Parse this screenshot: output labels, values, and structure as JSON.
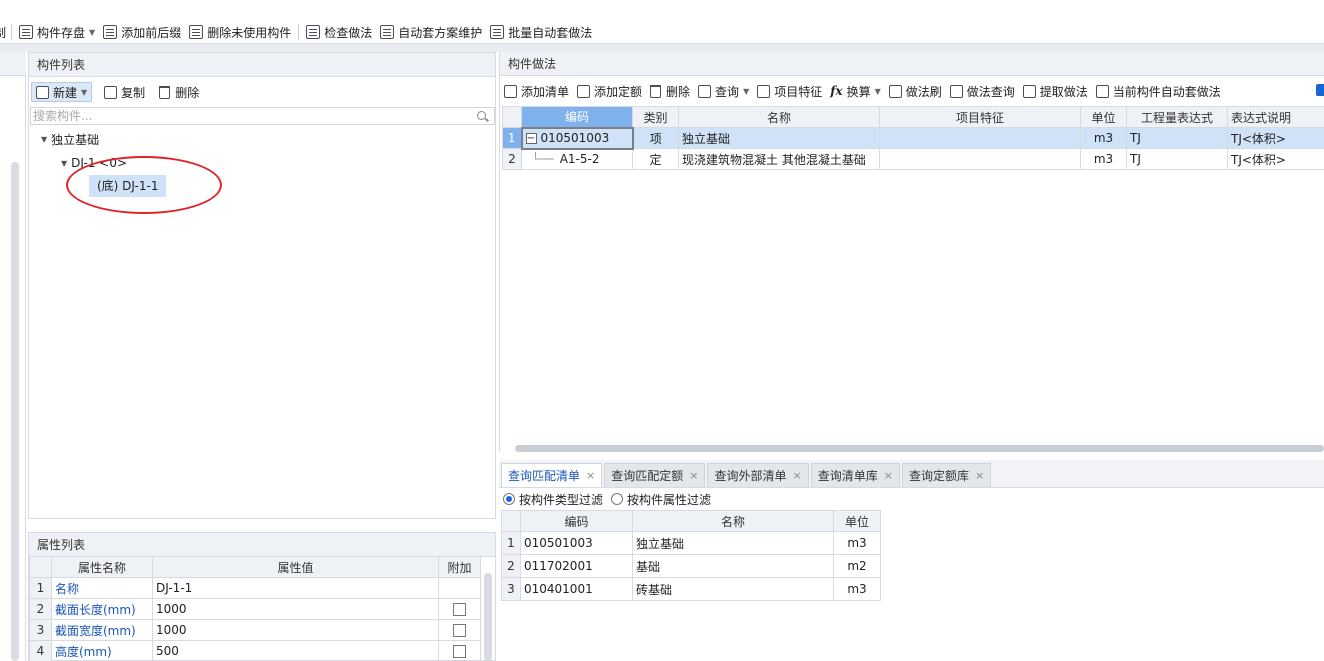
{
  "top_toolbar": {
    "items": [
      {
        "label": "制",
        "icon": "partial-icon"
      },
      {
        "label": "构件存盘",
        "icon": "save-component-icon",
        "dropdown": true
      },
      {
        "label": "添加前后缀",
        "icon": "add-prefix-icon"
      },
      {
        "label": "删除未使用构件",
        "icon": "delete-unused-icon"
      },
      {
        "label": "检查做法",
        "icon": "check-method-icon"
      },
      {
        "label": "自动套方案维护",
        "icon": "auto-scheme-icon"
      },
      {
        "label": "批量自动套做法",
        "icon": "batch-auto-icon"
      }
    ]
  },
  "component_list": {
    "title": "构件列表",
    "new_label": "新建",
    "copy_label": "复制",
    "delete_label": "删除",
    "search_placeholder": "搜索构件...",
    "tree": {
      "root": "独立基础",
      "child": "DJ-1 <0>",
      "leaf": "(底) DJ-1-1"
    }
  },
  "attributes": {
    "title": "属性列表",
    "headers": [
      "属性名称",
      "属性值",
      "附加"
    ],
    "rows": [
      {
        "n": "1",
        "name": "名称",
        "value": "DJ-1-1",
        "extra": false
      },
      {
        "n": "2",
        "name": "截面长度(mm)",
        "value": "1000",
        "extra": true
      },
      {
        "n": "3",
        "name": "截面宽度(mm)",
        "value": "1000",
        "extra": true
      },
      {
        "n": "4",
        "name": "高度(mm)",
        "value": "500",
        "extra": true
      }
    ]
  },
  "method": {
    "title": "构件做法",
    "tools": [
      {
        "label": "添加清单",
        "icon": "add-list-icon"
      },
      {
        "label": "添加定额",
        "icon": "add-quota-icon"
      },
      {
        "label": "删除",
        "icon": "trash-icon"
      },
      {
        "label": "查询",
        "icon": "query-icon",
        "dropdown": true
      },
      {
        "label": "项目特征",
        "icon": "feature-icon"
      },
      {
        "label": "换算",
        "icon": "fx-icon",
        "dropdown": true
      },
      {
        "label": "做法刷",
        "icon": "brush-icon"
      },
      {
        "label": "做法查询",
        "icon": "method-query-icon"
      },
      {
        "label": "提取做法",
        "icon": "extract-icon"
      },
      {
        "label": "当前构件自动套做法",
        "icon": "auto-apply-icon"
      }
    ],
    "headers": [
      "编码",
      "类别",
      "名称",
      "项目特征",
      "单位",
      "工程量表达式",
      "表达式说明"
    ],
    "rows": [
      {
        "n": "1",
        "code": "010501003",
        "cat": "项",
        "name": "独立基础",
        "feature": "",
        "unit": "m3",
        "expr": "TJ",
        "desc": "TJ<体积>"
      },
      {
        "n": "2",
        "code": "A1-5-2",
        "cat": "定",
        "name": "现浇建筑物混凝土 其他混凝土基础",
        "feature": "",
        "unit": "m3",
        "expr": "TJ",
        "desc": "TJ<体积>"
      }
    ]
  },
  "bottom_tabs": [
    {
      "label": "查询匹配清单",
      "active": true
    },
    {
      "label": "查询匹配定额",
      "active": false
    },
    {
      "label": "查询外部清单",
      "active": false
    },
    {
      "label": "查询清单库",
      "active": false
    },
    {
      "label": "查询定额库",
      "active": false
    }
  ],
  "filter": {
    "option1": "按构件类型过滤",
    "option2": "按构件属性过滤",
    "selected": "option1"
  },
  "match_list": {
    "headers": [
      "编码",
      "名称",
      "单位"
    ],
    "rows": [
      {
        "n": "1",
        "code": "010501003",
        "name": "独立基础",
        "unit": "m3"
      },
      {
        "n": "2",
        "code": "011702001",
        "name": "基础",
        "unit": "m2"
      },
      {
        "n": "3",
        "code": "010401001",
        "name": "砖基础",
        "unit": "m3"
      }
    ]
  },
  "colors": {
    "accent": "#1a64d6",
    "selection": "#cfe2f7",
    "annotation": "#e0242b"
  }
}
